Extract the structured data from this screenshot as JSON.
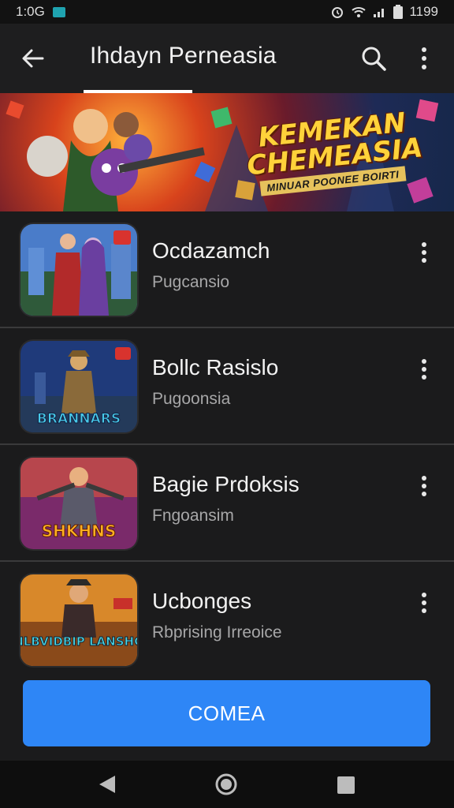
{
  "status_bar": {
    "time": "1:0G",
    "battery_text": "1199"
  },
  "app_bar": {
    "title": "Ihdayn Perneasia"
  },
  "banner": {
    "title": "KEMEKAN CHEMEASIA",
    "subtitle": "MINUAR POONEE BOIRTI"
  },
  "list": [
    {
      "title": "Ocdazamch",
      "subtitle": "Pugcansio"
    },
    {
      "title": "Bollc Rasislo",
      "subtitle": "Pugoonsia",
      "thumb_text": "BRANNARS"
    },
    {
      "title": "Bagie Prdoksis",
      "subtitle": "Fngoansim",
      "thumb_text": "SHKHNS"
    },
    {
      "title": "Ucbonges",
      "subtitle": "Rbprising Irreoice",
      "thumb_text": "NLBVIDBIP LANSHO"
    }
  ],
  "primary_button": {
    "label": "COMEA"
  },
  "colors": {
    "accent": "#2e86f6",
    "background": "#1b1b1c"
  }
}
